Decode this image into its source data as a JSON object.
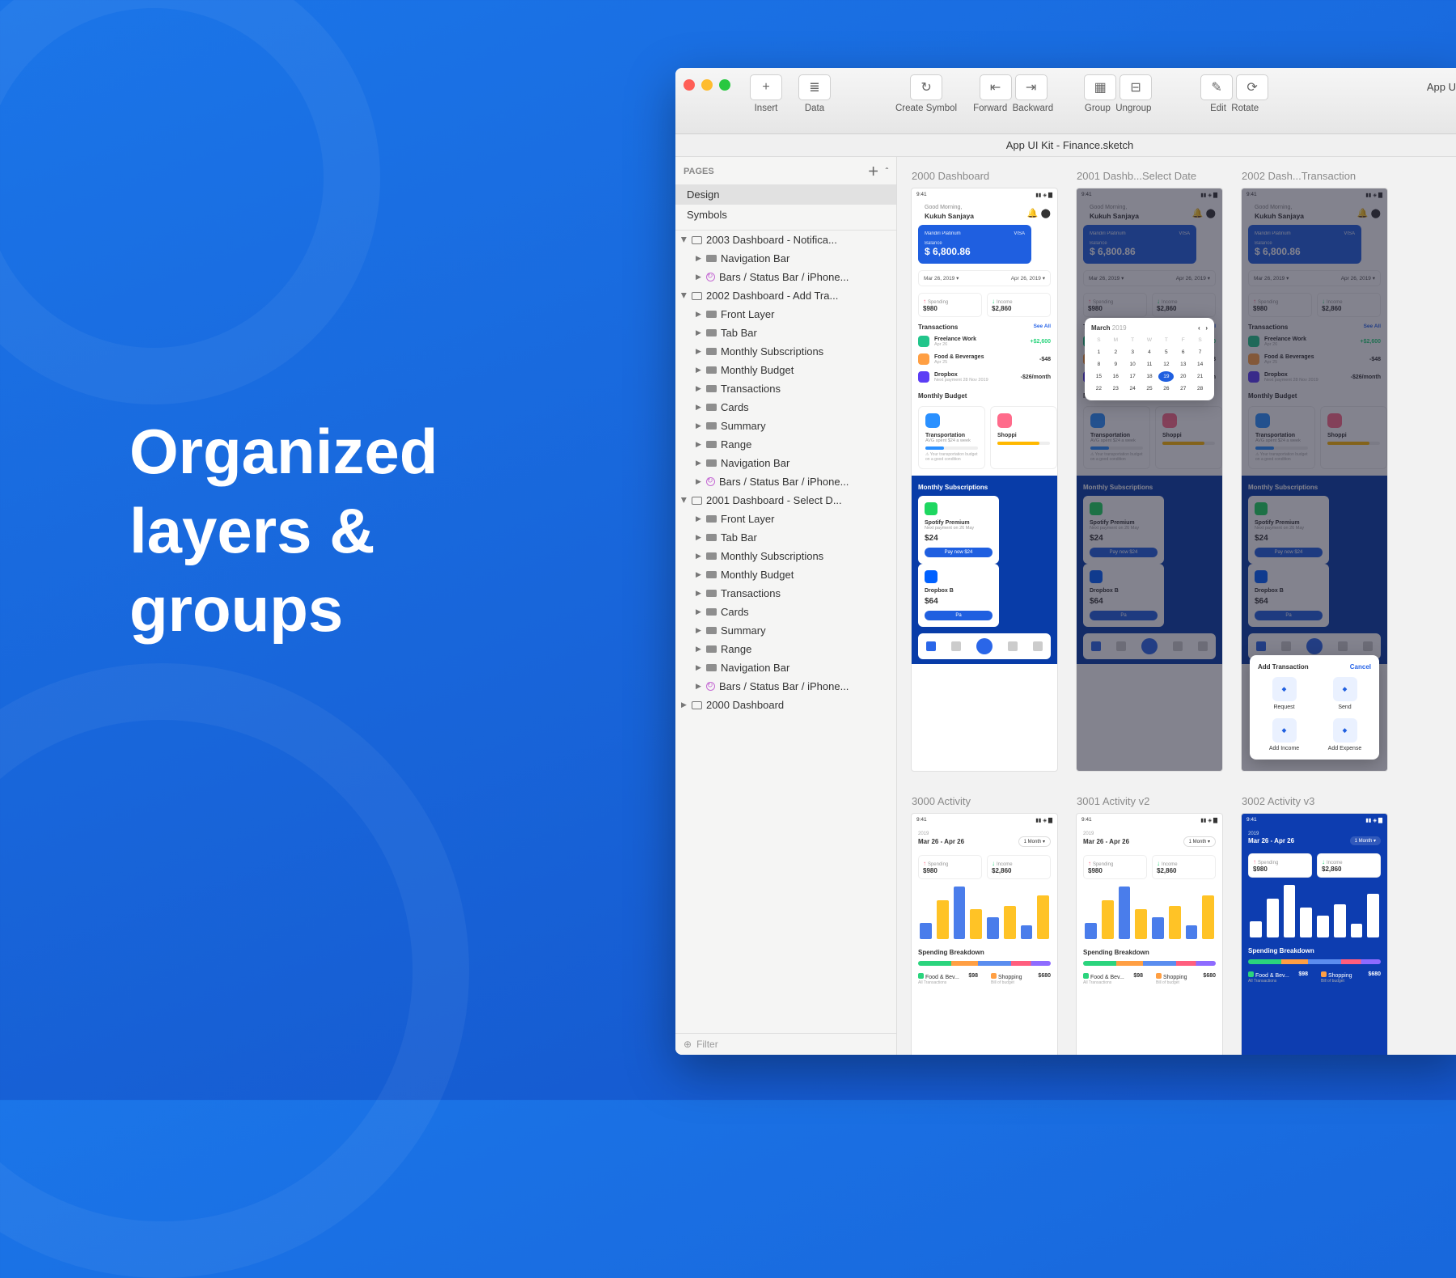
{
  "hero": "Organized\nlayers &\ngroups",
  "window": {
    "titleRight": "App U",
    "document": "App UI Kit - Finance.sketch",
    "toolbar": [
      {
        "label": "Insert",
        "buttons": [
          "+"
        ]
      },
      {
        "label": "Data",
        "buttons": [
          "≣"
        ]
      },
      {
        "label": "Create Symbol",
        "buttons": [
          "↻"
        ]
      },
      {
        "label_a": "Forward",
        "label_b": "Backward",
        "buttons": [
          "⇤",
          "⇥"
        ]
      },
      {
        "label_a": "Group",
        "label_b": "Ungroup",
        "buttons": [
          "▦",
          "⊟"
        ]
      },
      {
        "label_a": "Edit",
        "label_b": "Rotate",
        "buttons": [
          "✎",
          "⟳"
        ]
      }
    ],
    "pagesHeader": "PAGES",
    "pages": [
      "Design",
      "Symbols"
    ],
    "layers": [
      {
        "k": "artb",
        "open": true,
        "n": "2003 Dashboard - Notifica..."
      },
      {
        "k": "fold",
        "d": 1,
        "n": "Navigation Bar"
      },
      {
        "k": "sym",
        "d": 1,
        "n": "Bars / Status Bar / iPhone..."
      },
      {
        "k": "artb",
        "open": true,
        "n": "2002 Dashboard - Add Tra..."
      },
      {
        "k": "fold",
        "d": 1,
        "n": "Front Layer"
      },
      {
        "k": "fold",
        "d": 1,
        "n": "Tab Bar"
      },
      {
        "k": "fold",
        "d": 1,
        "n": "Monthly Subscriptions"
      },
      {
        "k": "fold",
        "d": 1,
        "n": "Monthly Budget"
      },
      {
        "k": "fold",
        "d": 1,
        "n": "Transactions"
      },
      {
        "k": "fold",
        "d": 1,
        "n": "Cards"
      },
      {
        "k": "fold",
        "d": 1,
        "n": "Summary"
      },
      {
        "k": "fold",
        "d": 1,
        "n": "Range"
      },
      {
        "k": "fold",
        "d": 1,
        "n": "Navigation Bar"
      },
      {
        "k": "sym",
        "d": 1,
        "n": "Bars / Status Bar / iPhone..."
      },
      {
        "k": "artb",
        "open": true,
        "n": "2001 Dashboard - Select D..."
      },
      {
        "k": "fold",
        "d": 1,
        "n": "Front Layer"
      },
      {
        "k": "fold",
        "d": 1,
        "n": "Tab Bar"
      },
      {
        "k": "fold",
        "d": 1,
        "n": "Monthly Subscriptions"
      },
      {
        "k": "fold",
        "d": 1,
        "n": "Monthly Budget"
      },
      {
        "k": "fold",
        "d": 1,
        "n": "Transactions"
      },
      {
        "k": "fold",
        "d": 1,
        "n": "Cards"
      },
      {
        "k": "fold",
        "d": 1,
        "n": "Summary"
      },
      {
        "k": "fold",
        "d": 1,
        "n": "Range"
      },
      {
        "k": "fold",
        "d": 1,
        "n": "Navigation Bar"
      },
      {
        "k": "sym",
        "d": 1,
        "n": "Bars / Status Bar / iPhone..."
      },
      {
        "k": "artb",
        "open": false,
        "n": "2000 Dashboard"
      }
    ],
    "filter": "Filter"
  },
  "artboards": {
    "row1": [
      {
        "label": "2000 Dashboard"
      },
      {
        "label": "2001 Dashb...Select Date"
      },
      {
        "label": "2002 Dash...Transaction"
      }
    ],
    "row2": [
      {
        "label": "3000 Activity"
      },
      {
        "label": "3001 Activity v2"
      },
      {
        "label": "3002 Activity v3"
      }
    ]
  },
  "mock": {
    "time": "9:41",
    "greet": "Good Morning,",
    "user": "Kukuh Sanjaya",
    "card": {
      "name": "Mandiri Platinum",
      "brand": "VISA",
      "balLabel": "Balance",
      "amount": "$ 6,800.86"
    },
    "range": {
      "from": "Mar 26, 2019",
      "to": "Apr 26, 2019"
    },
    "summary": [
      {
        "l": "Spending",
        "v": "$980"
      },
      {
        "l": "Income",
        "v": "$2,860"
      }
    ],
    "txHeader": "Transactions",
    "seeAll": "See All",
    "txns": [
      {
        "n": "Freelance Work",
        "d": "Apr 26",
        "v": "+$2,600",
        "c": "#22c58b"
      },
      {
        "n": "Food & Beverages",
        "d": "Apr 25",
        "v": "-$48",
        "c": "#ff9f43"
      },
      {
        "n": "Dropbox",
        "d": "Next payment 28 Nov 2019",
        "v": "-$26/month",
        "c": "#5b3df5"
      }
    ],
    "budgetHeader": "Monthly Budget",
    "budgets": [
      {
        "n": "Transportation",
        "s": "AVG spent $24 a week",
        "c": "#2a90ff",
        "bar": 35,
        "note": "Your transportation budget on a good condition"
      },
      {
        "n": "Shoppi",
        "s": "",
        "c": "#ff6b8b",
        "bar": 80
      }
    ],
    "subsHeader": "Monthly Subscriptions",
    "subs": [
      {
        "n": "Spotify Premium",
        "d": "Next payment on 26 May",
        "p": "$24",
        "btn": "Pay now $24",
        "c": "#1ed760"
      },
      {
        "n": "Dropbox B",
        "d": "",
        "p": "$64",
        "btn": "Pa",
        "c": "#0061ff"
      }
    ],
    "calendar": {
      "month": "March",
      "year": "2019",
      "sel": 19
    },
    "addTxn": {
      "title": "Add Transaction",
      "cancel": "Cancel",
      "items": [
        "Request",
        "Send",
        "Add Income",
        "Add Expense"
      ]
    },
    "activity": {
      "year": "2019",
      "range": "Mar 26 - Apr 26",
      "pill": "1 Month",
      "bars": [
        30,
        70,
        95,
        55,
        40,
        60,
        25,
        80
      ],
      "brkTitle": "Spending Breakdown",
      "items": [
        {
          "n": "Food & Bev...",
          "v": "$98"
        },
        {
          "n": "Shopping",
          "v": "$680"
        }
      ],
      "sub": [
        "All Transactions",
        "Bill of budget"
      ]
    }
  }
}
